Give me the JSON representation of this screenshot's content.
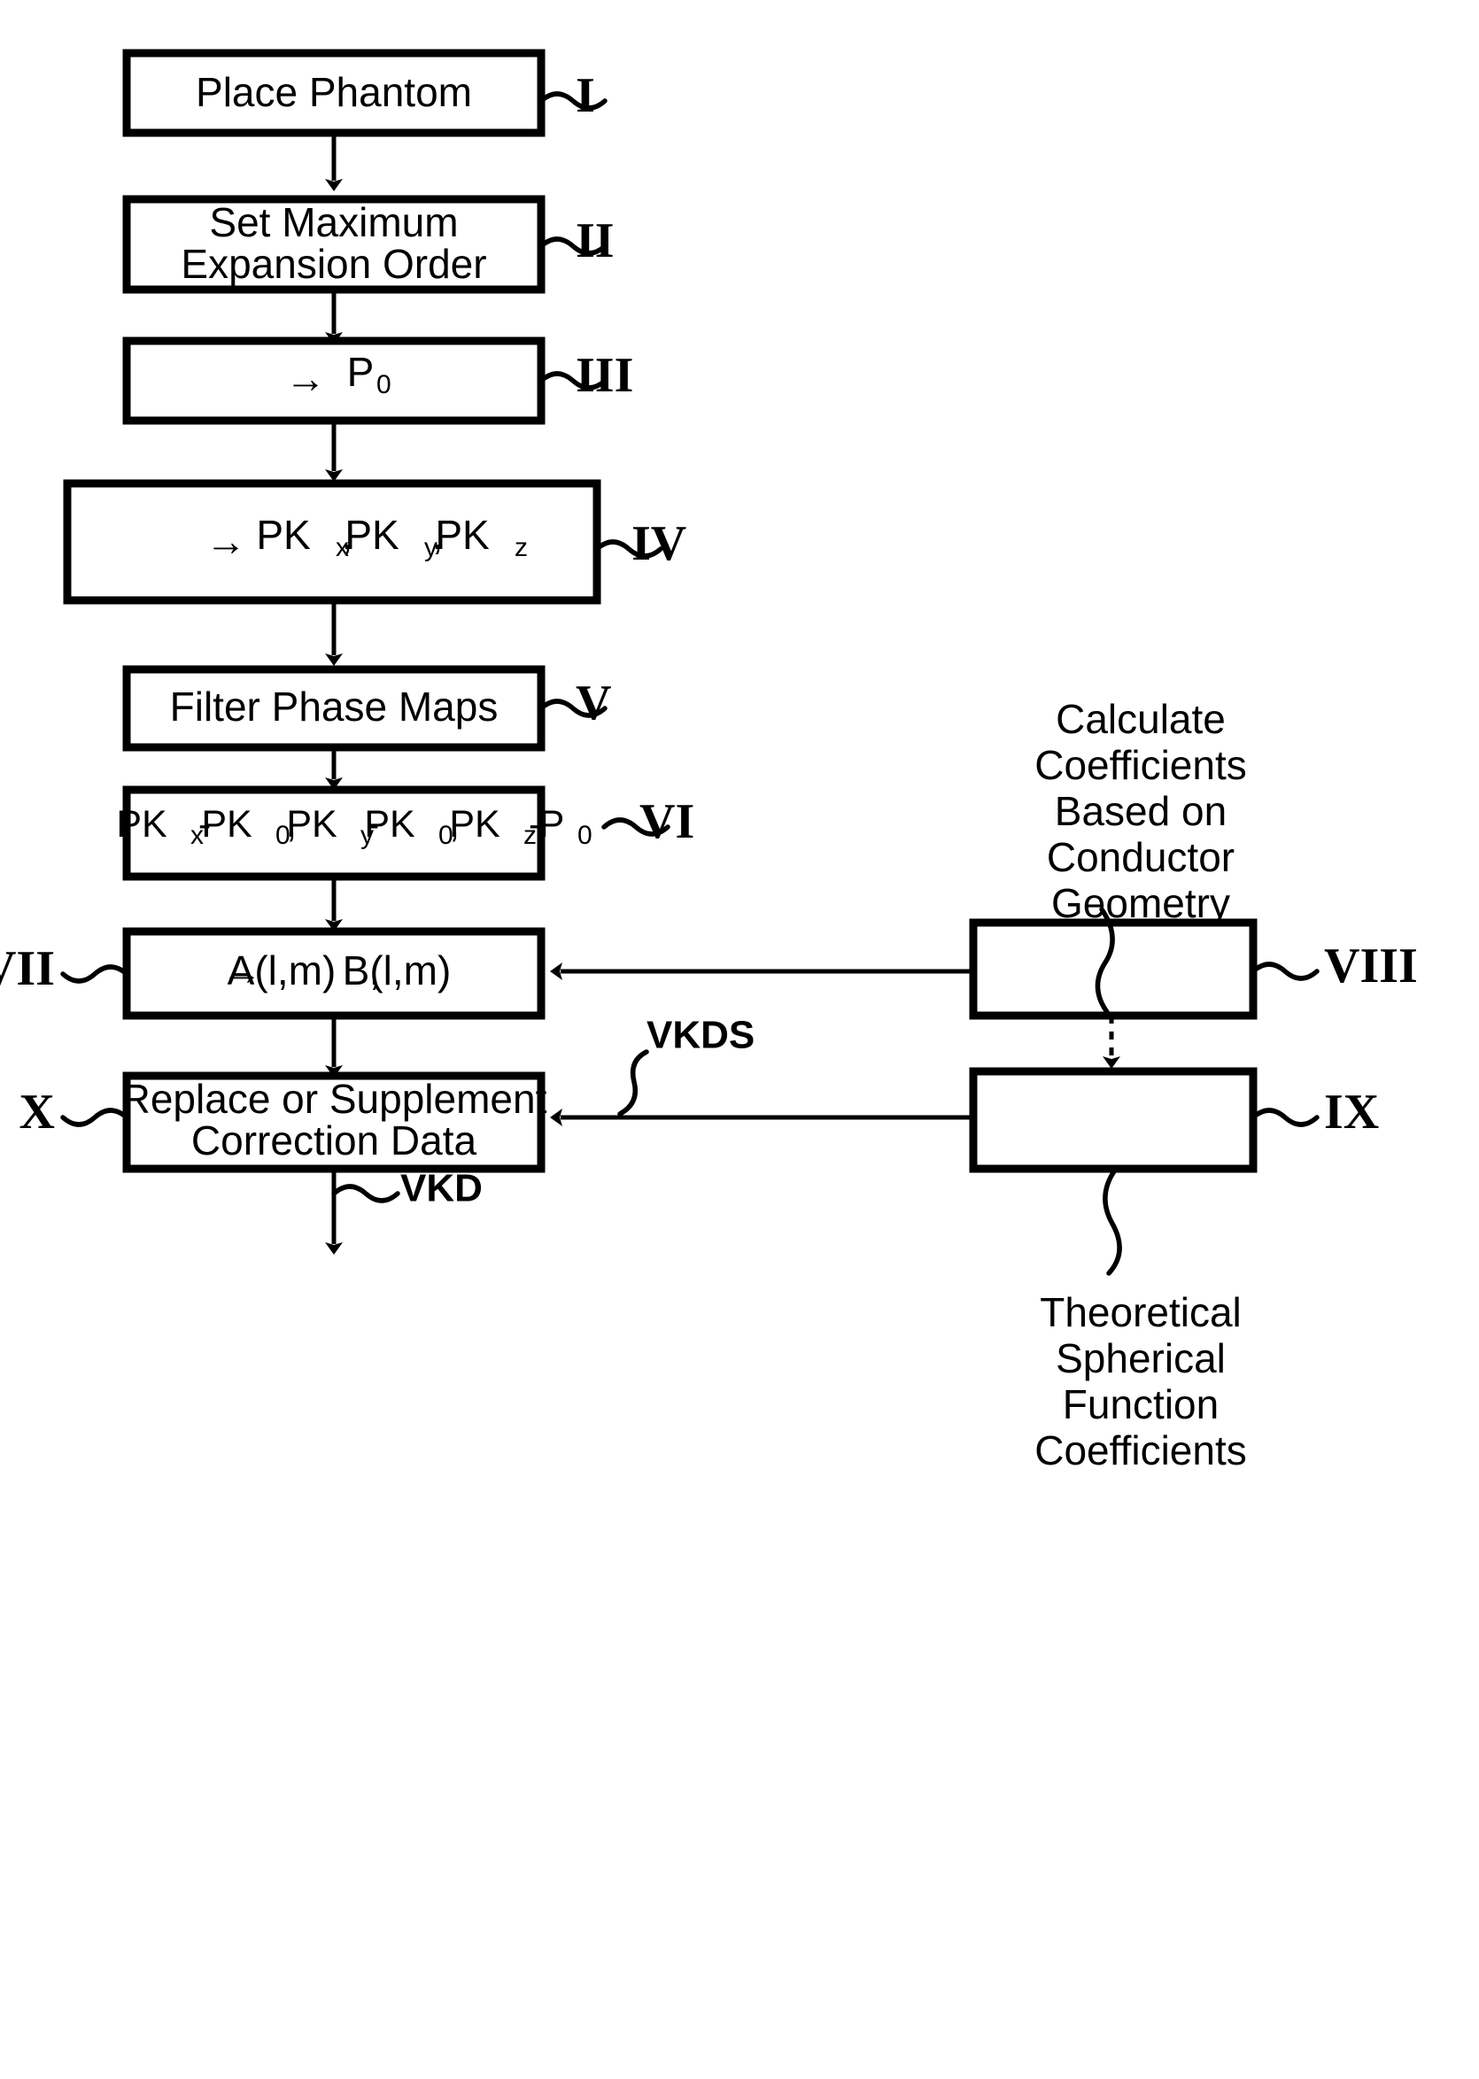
{
  "figure": {
    "type": "patent-flowchart",
    "title": "",
    "background_color": "#ffffff",
    "line_color": "#000000"
  },
  "steps": [
    {
      "id": "I",
      "roman": "I",
      "roman_side": "right",
      "label": "Place Phantom",
      "lines": [
        "Place Phantom"
      ]
    },
    {
      "id": "II",
      "roman": "II",
      "roman_side": "right",
      "label": "Set Maximum Expansion Order",
      "lines": [
        "Set Maximum",
        "Expansion Order"
      ]
    },
    {
      "id": "III",
      "roman": "III",
      "roman_side": "right",
      "label": "→ P0",
      "lines": [
        "→ P0"
      ]
    },
    {
      "id": "IV",
      "roman": "IV",
      "roman_side": "right",
      "label": "→ PKx, PKy, PKz",
      "lines": [
        "→ PKx, PKy, PKz"
      ]
    },
    {
      "id": "V",
      "roman": "V",
      "roman_side": "right",
      "label": "Filter Phase Maps",
      "lines": [
        "Filter Phase Maps"
      ]
    },
    {
      "id": "VI",
      "roman": "VI",
      "roman_side": "right",
      "label": "PKx- PK0, PKy-PK0, PKz-P0",
      "lines": [
        "PKx- PK0, PKy-PK0, PKz-P0"
      ]
    },
    {
      "id": "VII",
      "roman": "VII",
      "roman_side": "left",
      "label": "→ A(l,m), B(l,m)",
      "lines": [
        "→ A(l,m), B(l,m)"
      ]
    },
    {
      "id": "VIII",
      "roman": "VIII",
      "roman_side": "right",
      "label": "",
      "lines": [],
      "callout": "Calculate Coefficients Based on Conductor Geometry",
      "callout_lines": [
        "Calculate",
        "Coefficients",
        "Based on",
        "Conductor",
        "Geometry"
      ],
      "callout_position": "above"
    },
    {
      "id": "IX",
      "roman": "IX",
      "roman_side": "right",
      "label": "",
      "lines": [],
      "callout": "Theoretical Spherical Function Coefficients",
      "callout_lines": [
        "Theoretical",
        "Spherical",
        "Function",
        "Coefficients"
      ],
      "callout_position": "below"
    },
    {
      "id": "X",
      "roman": "X",
      "roman_side": "left",
      "label": "Replace or Supplement Correction Data",
      "lines": [
        "Replace or Supplement",
        "Correction Data"
      ]
    }
  ],
  "signal_labels": [
    {
      "id": "VKDS",
      "text": "VKDS"
    },
    {
      "id": "VKD",
      "text": "VKD"
    }
  ],
  "math_tokens": {
    "arrow": "→",
    "p0_base": "P",
    "p0_sub": "0",
    "pk_base": "PK",
    "sub_x": "x",
    "sub_y": "y",
    "sub_z": "z",
    "sub_0": "0",
    "comma": ",",
    "minus": "-",
    "a_of": "A(l,m)",
    "b_of": "B(l,m)"
  }
}
